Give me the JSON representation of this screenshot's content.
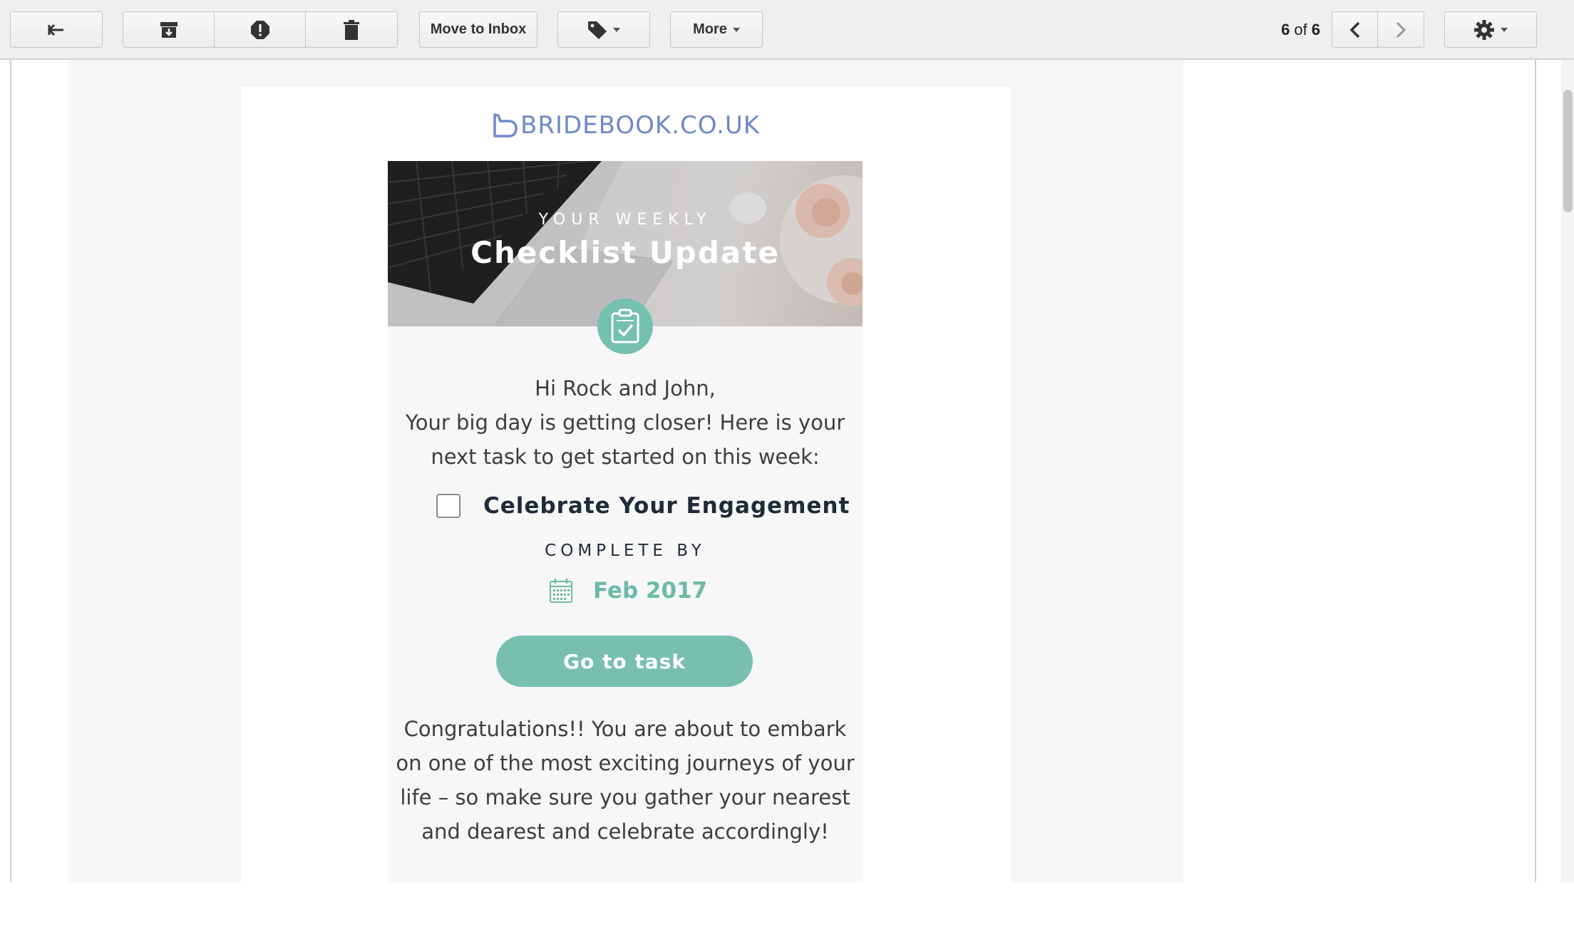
{
  "toolbar": {
    "move_to_inbox_label": "Move to Inbox",
    "more_label": "More",
    "pager_current": "6",
    "pager_of": "of",
    "pager_total": "6",
    "icons": [
      "back-arrow-icon",
      "archive-icon",
      "report-spam-icon",
      "trash-icon",
      "label-tag-icon",
      "chevron-left-icon",
      "chevron-right-icon",
      "gear-icon"
    ]
  },
  "email": {
    "logo_text": "BRIDEBOOK.CO.UK",
    "hero_subtitle": "YOUR WEEKLY",
    "hero_title": "Checklist Update",
    "greeting": "Hi Rock and John,",
    "intro_line1": "Your big day is getting closer! Here is your",
    "intro_line2": "next task to get started on this week:",
    "task_title": "Celebrate Your Engagement",
    "task_checked": false,
    "complete_by_label": "COMPLETE BY",
    "due_date": "Feb 2017",
    "cta_label": "Go to task",
    "body_line1": "Congratulations!! You are about to embark",
    "body_line2": "on one of the most exciting journeys of your",
    "body_line3": "life – so make sure you gather your nearest",
    "body_line4": "and dearest and celebrate accordingly!"
  },
  "colors": {
    "accent": "#78c0ad",
    "logo": "#6f89c8",
    "heading": "#1f2a3a"
  }
}
